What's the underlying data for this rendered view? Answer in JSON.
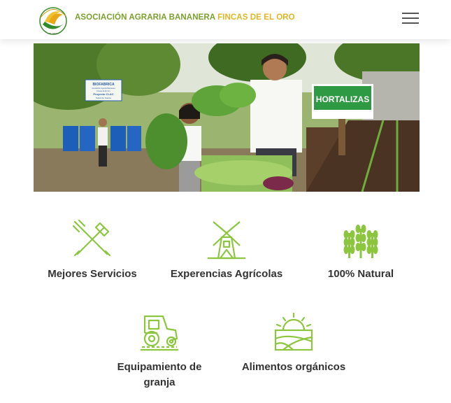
{
  "header": {
    "brand_primary": "ASOCIACIÓN AGRARIA BANANERA",
    "brand_secondary": "FINCAS DE EL ORO",
    "logo_icon": "banana-logo-icon",
    "menu_icon": "hamburger-menu-icon"
  },
  "hero": {
    "sign_biofabrica": [
      "BIOFABRICA",
      "Asociación Agraria Bananera",
      "Fincas de El Oro",
      "Proyecto CLAC",
      "Salud de Suelos"
    ],
    "sign_hortalizas": "HORTALIZAS"
  },
  "features": [
    {
      "label": "Mejores Servicios",
      "icon": "pitchfork-shovel-icon"
    },
    {
      "label": "Experencias Agrícolas",
      "icon": "windmill-icon"
    },
    {
      "label": "100% Natural",
      "icon": "wheat-icon"
    },
    {
      "label": "Equipamiento de granja",
      "icon": "tractor-icon"
    },
    {
      "label": "Alimentos orgánicos",
      "icon": "sun-field-icon"
    }
  ],
  "colors": {
    "brand_green": "#7aa12b",
    "brand_yellow": "#e0b624",
    "icon_green": "#8cc63f",
    "text_dark": "#333333"
  }
}
